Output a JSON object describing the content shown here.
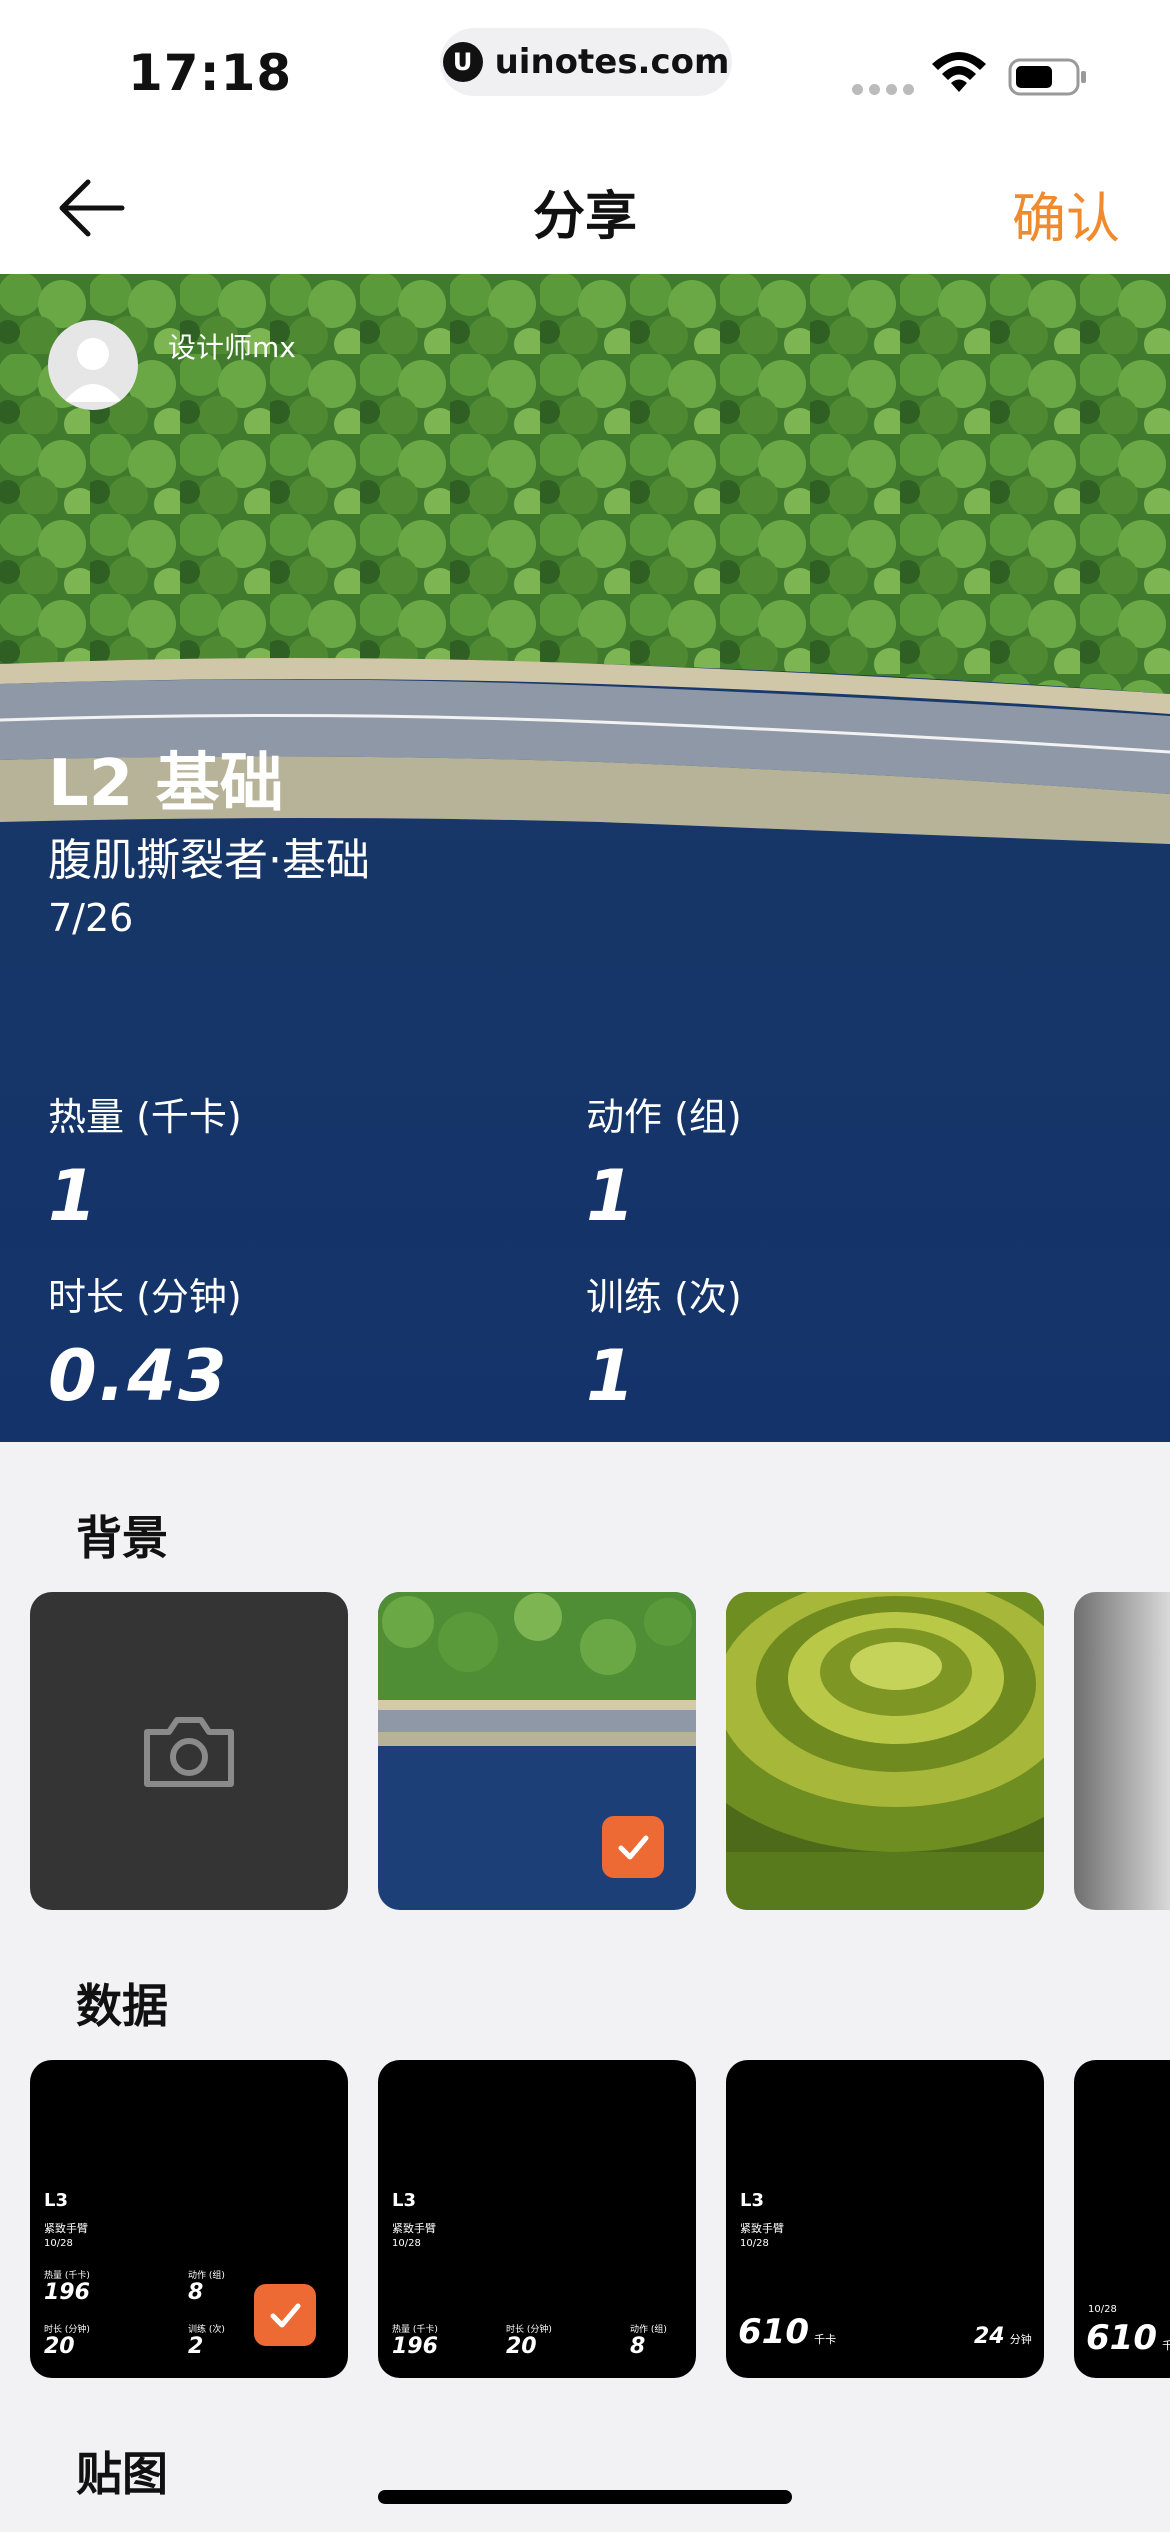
{
  "status_bar": {
    "time": "17:18",
    "url": "uinotes.com",
    "url_logo": "U",
    "icons": [
      "signal-dots-icon",
      "wifi-icon",
      "battery-icon"
    ]
  },
  "nav": {
    "title": "分享",
    "confirm_label": "确认",
    "confirm_color": "#ef8a2e",
    "back_icon": "arrow-left-icon"
  },
  "card": {
    "username": "设计师mx",
    "level": "L2 基础",
    "course": "腹肌撕裂者·基础",
    "date": "7/26",
    "stats": [
      {
        "label": "热量 (千卡)",
        "value": "1"
      },
      {
        "label": "动作 (组)",
        "value": "1"
      },
      {
        "label": "时长 (分钟)",
        "value": "0.43"
      },
      {
        "label": "训练 (次)",
        "value": "1"
      }
    ]
  },
  "background_section": {
    "title": "背景",
    "items": [
      {
        "kind": "camera",
        "icon": "camera-icon"
      },
      {
        "kind": "road-lake",
        "selected": true
      },
      {
        "kind": "rice-terraces",
        "selected": false
      },
      {
        "kind": "gray",
        "selected": false
      }
    ]
  },
  "data_section": {
    "title": "数据",
    "items": [
      {
        "level": "L3",
        "name": "紧致手臂",
        "date": "10/28",
        "stats": [
          {
            "label": "热量 (千卡)",
            "value": "196"
          },
          {
            "label": "动作 (组)",
            "value": "8"
          },
          {
            "label": "时长 (分钟)",
            "value": "20"
          },
          {
            "label": "训练 (次)",
            "value": "2"
          }
        ],
        "selected": true
      },
      {
        "level": "L3",
        "name": "紧致手臂",
        "date": "10/28",
        "stats": [
          {
            "label": "热量 (千卡)",
            "value": "196"
          },
          {
            "label": "时长 (分钟)",
            "value": "20"
          },
          {
            "label": "动作 (组)",
            "value": "8"
          }
        ],
        "selected": false
      },
      {
        "level": "L3",
        "name": "紧致手臂",
        "date": "10/28",
        "big_value": "610",
        "big_unit": "千卡",
        "small_value": "24",
        "small_unit": "分钟",
        "selected": false
      },
      {
        "date": "10/28",
        "big_value": "610",
        "big_unit": "千",
        "selected": false
      }
    ]
  },
  "sticker_section": {
    "title": "贴图"
  },
  "accent_color": "#ee6a35"
}
